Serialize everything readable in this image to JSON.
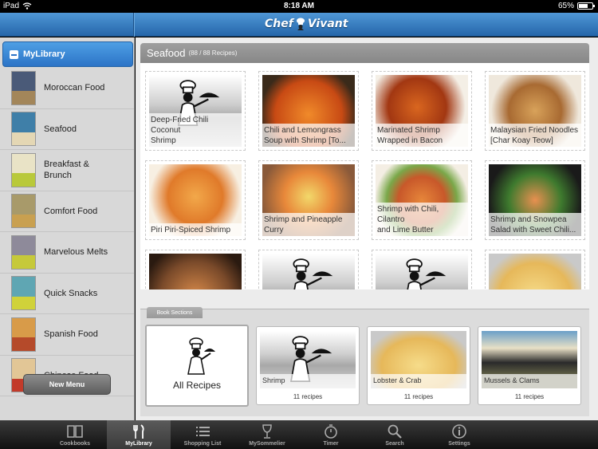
{
  "status": {
    "device": "iPad",
    "time": "8:18 AM",
    "battery": "65%",
    "battery_level": 0.65
  },
  "nav": {
    "logo_text_1": "Chef",
    "logo_text_2": "Vivant"
  },
  "sidebar": {
    "header": "MyLibrary",
    "books": [
      {
        "label": "Moroccan Food",
        "color": "#4a5a78",
        "band": "#a3865a"
      },
      {
        "label": "Seafood",
        "color": "#3f7fa8",
        "band": "#e4d7b4"
      },
      {
        "label": "Breakfast &\nBrunch",
        "color": "#e9e3c6",
        "band": "#b9c93a"
      },
      {
        "label": "Comfort Food",
        "color": "#a89a6a",
        "band": "#c9a050"
      },
      {
        "label": "Marvelous Melts",
        "color": "#8e8a9a",
        "band": "#c6c93a"
      },
      {
        "label": "Quick Snacks",
        "color": "#5fa6b3",
        "band": "#d0d23a"
      },
      {
        "label": "Spanish Food",
        "color": "#d89b49",
        "band": "#b54a2a"
      },
      {
        "label": "Chinese Food",
        "color": "#e2c696",
        "band": "#c23a2a"
      }
    ],
    "new_menu": "New Menu"
  },
  "main": {
    "section_title": "Seafood",
    "section_count": "(88 / 88 Recipes)",
    "recipes": [
      {
        "name": "Deep-Fried Chili Coconut\nShrimp",
        "image": "chef"
      },
      {
        "name": "Chili and Lemongrass\nSoup with Shrimp [To...",
        "image": "soup"
      },
      {
        "name": "Marinated Shrimp\nWrapped in Bacon",
        "image": "bacon"
      },
      {
        "name": "Malaysian Fried Noodles\n[Char Koay Teow]",
        "image": "noodles"
      },
      {
        "name": "Piri Piri-Spiced Shrimp",
        "image": "piri"
      },
      {
        "name": "Shrimp and Pineapple\nCurry",
        "image": "curry"
      },
      {
        "name": "Shrimp with Chili, Cilantro\nand Lime Butter",
        "image": "lime"
      },
      {
        "name": "Shrimp and Snowpea\nSalad with Sweet Chili...",
        "image": "salad"
      },
      {
        "name": "",
        "image": "noodles2"
      },
      {
        "name": "",
        "image": "chef"
      },
      {
        "name": "",
        "image": "chef"
      },
      {
        "name": "",
        "image": "omelet"
      }
    ],
    "book_sections_tab": "Book Sections",
    "all_recipes": "All Recipes",
    "sections": [
      {
        "name": "Shrimp",
        "count": "11 recipes",
        "image": "chef"
      },
      {
        "name": "Lobster & Crab",
        "count": "11 recipes",
        "image": "omelet"
      },
      {
        "name": "Mussels & Clams",
        "count": "11 recipes",
        "image": "mussels"
      }
    ]
  },
  "tabbar": {
    "tabs": [
      {
        "label": "Cookbooks",
        "icon": "book-icon"
      },
      {
        "label": "MyLibrary",
        "icon": "fork-knife-icon"
      },
      {
        "label": "Shopping List",
        "icon": "list-icon"
      },
      {
        "label": "MySommelier",
        "icon": "wine-glass-icon"
      },
      {
        "label": "Timer",
        "icon": "stopwatch-icon"
      },
      {
        "label": "Search",
        "icon": "search-icon"
      },
      {
        "label": "Settings",
        "icon": "info-icon"
      }
    ],
    "active": "MyLibrary"
  }
}
